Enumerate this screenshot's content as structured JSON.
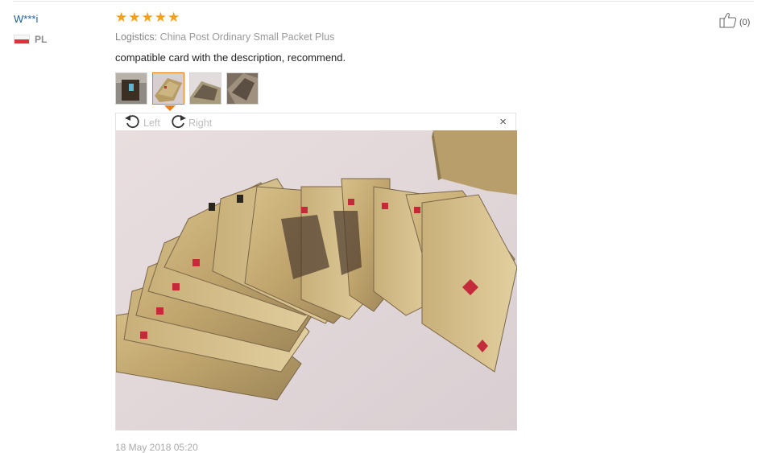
{
  "reviewer": {
    "name": "W***i",
    "country_code": "PL"
  },
  "rating": {
    "stars": 5,
    "max": 5,
    "color": "#f5a01a"
  },
  "logistics": {
    "label": "Logistics:",
    "value": "China Post Ordinary Small Packet Plus"
  },
  "review_text": "compatible card with the description, recommend.",
  "thumbnails": {
    "count": 4,
    "selected_index": 1
  },
  "viewer": {
    "rotate_left_label": "Left",
    "rotate_right_label": "Right",
    "close_label": "×"
  },
  "helpful": {
    "count_text": "(0)"
  },
  "date": "18 May 2018 05:20",
  "colors": {
    "accent": "#ea7c1a",
    "name": "#1f5f9e",
    "flag_red": "#e0303d"
  }
}
